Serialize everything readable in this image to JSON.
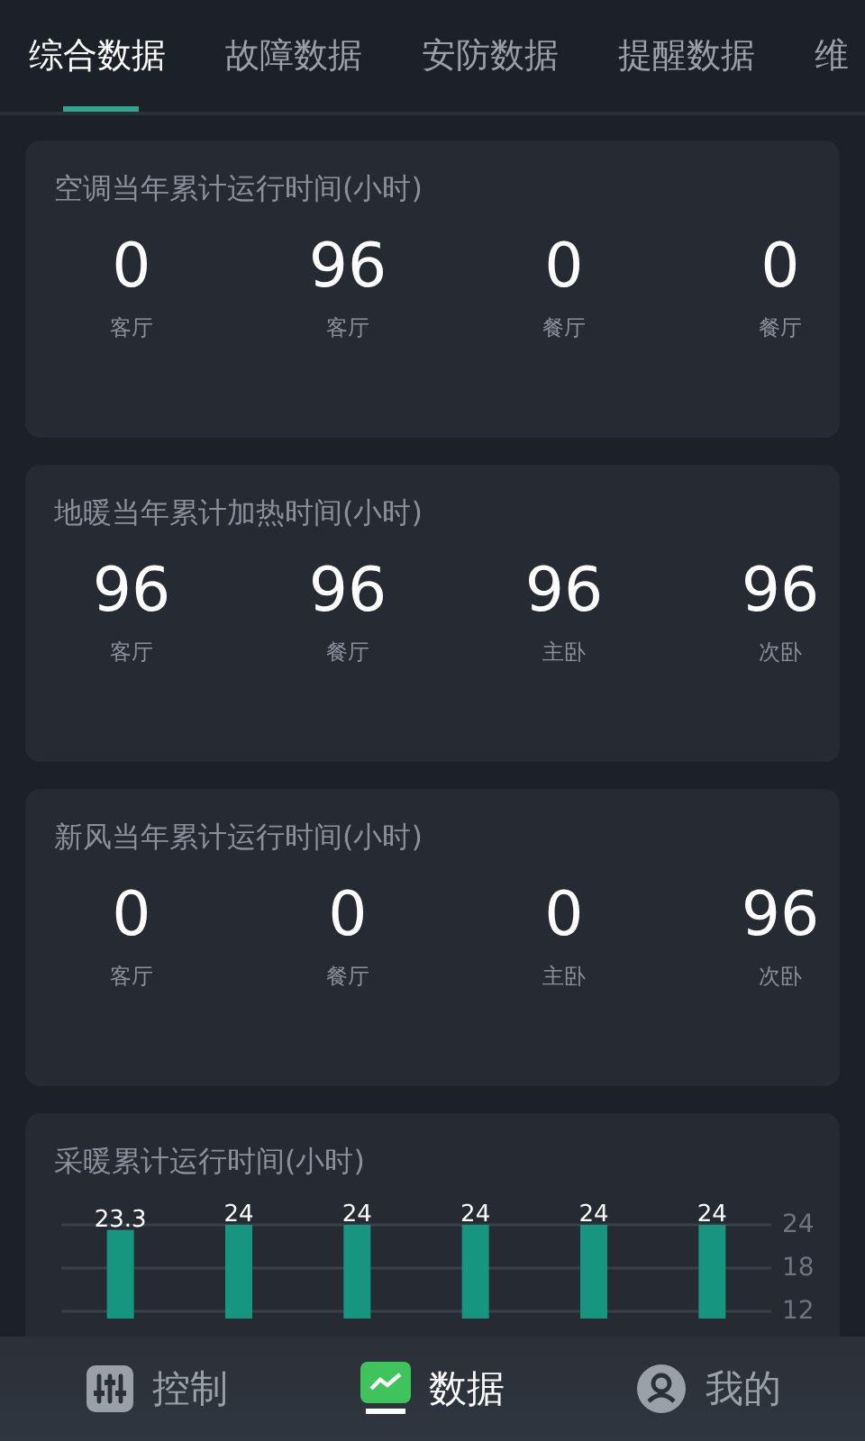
{
  "tabs": [
    {
      "label": "综合数据",
      "selected": true
    },
    {
      "label": "故障数据",
      "selected": false
    },
    {
      "label": "安防数据",
      "selected": false
    },
    {
      "label": "提醒数据",
      "selected": false
    },
    {
      "label": "维",
      "selected": false
    }
  ],
  "cards": [
    {
      "title": "空调当年累计运行时间(小时)",
      "stats": [
        {
          "value": "0",
          "room": "客厅"
        },
        {
          "value": "96",
          "room": "客厅"
        },
        {
          "value": "0",
          "room": "餐厅"
        },
        {
          "value": "0",
          "room": "餐厅"
        }
      ]
    },
    {
      "title": "地暖当年累计加热时间(小时)",
      "stats": [
        {
          "value": "96",
          "room": "客厅"
        },
        {
          "value": "96",
          "room": "餐厅"
        },
        {
          "value": "96",
          "room": "主卧"
        },
        {
          "value": "96",
          "room": "次卧"
        }
      ]
    },
    {
      "title": "新风当年累计运行时间(小时)",
      "stats": [
        {
          "value": "0",
          "room": "客厅"
        },
        {
          "value": "0",
          "room": "餐厅"
        },
        {
          "value": "0",
          "room": "主卧"
        },
        {
          "value": "96",
          "room": "次卧"
        }
      ]
    }
  ],
  "heating": {
    "title": "采暖累计运行时间(小时)",
    "chart_data": {
      "type": "bar",
      "values": [
        23.3,
        24,
        24,
        24,
        24,
        24
      ],
      "value_labels": [
        "23.3",
        "24",
        "24",
        "24",
        "24",
        "24"
      ],
      "yticks": [
        12,
        18,
        24
      ],
      "ylim": [
        11,
        24
      ],
      "grid": true,
      "data_labels": true
    }
  },
  "nav": [
    {
      "label": "控制",
      "kind": "sliders",
      "selected": false
    },
    {
      "label": "数据",
      "kind": "chart",
      "selected": true
    },
    {
      "label": "我的",
      "kind": "user",
      "selected": false
    }
  ]
}
